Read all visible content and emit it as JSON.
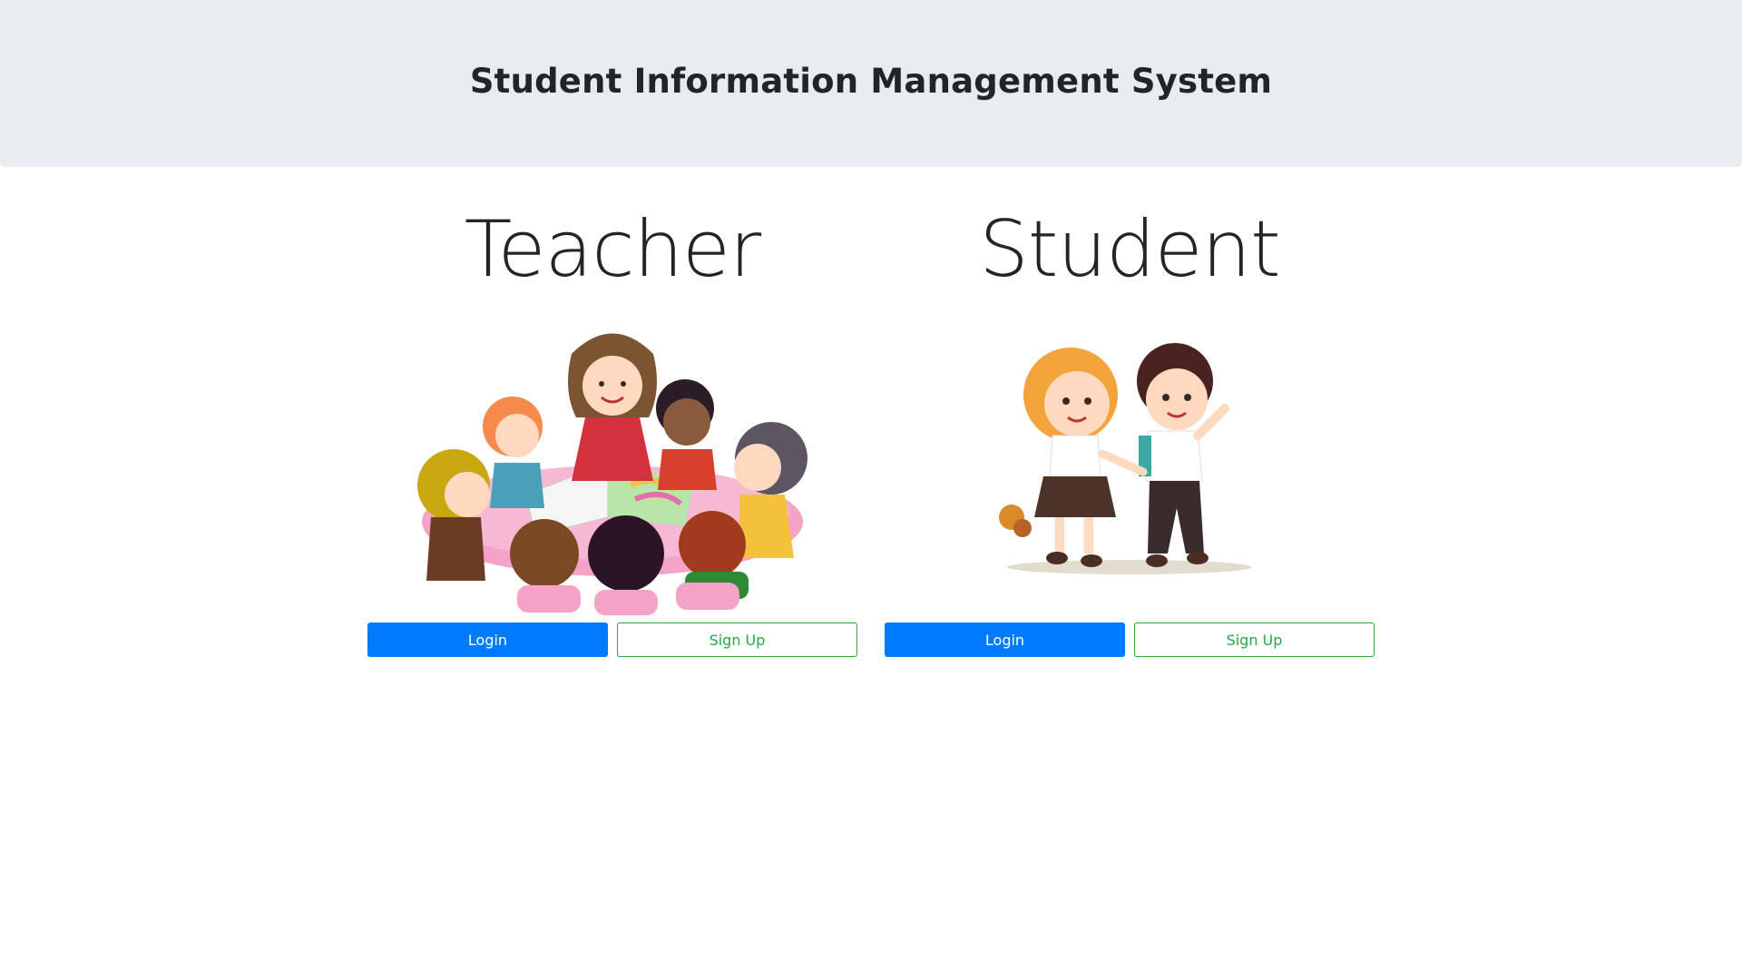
{
  "header": {
    "title": "Student Information Management System"
  },
  "sections": {
    "teacher": {
      "heading": "Teacher",
      "login_label": "Login",
      "signup_label": "Sign Up"
    },
    "student": {
      "heading": "Student",
      "login_label": "Login",
      "signup_label": "Sign Up"
    }
  },
  "colors": {
    "header_bg": "#e9ecef",
    "primary": "#007bff",
    "success": "#28a745"
  }
}
